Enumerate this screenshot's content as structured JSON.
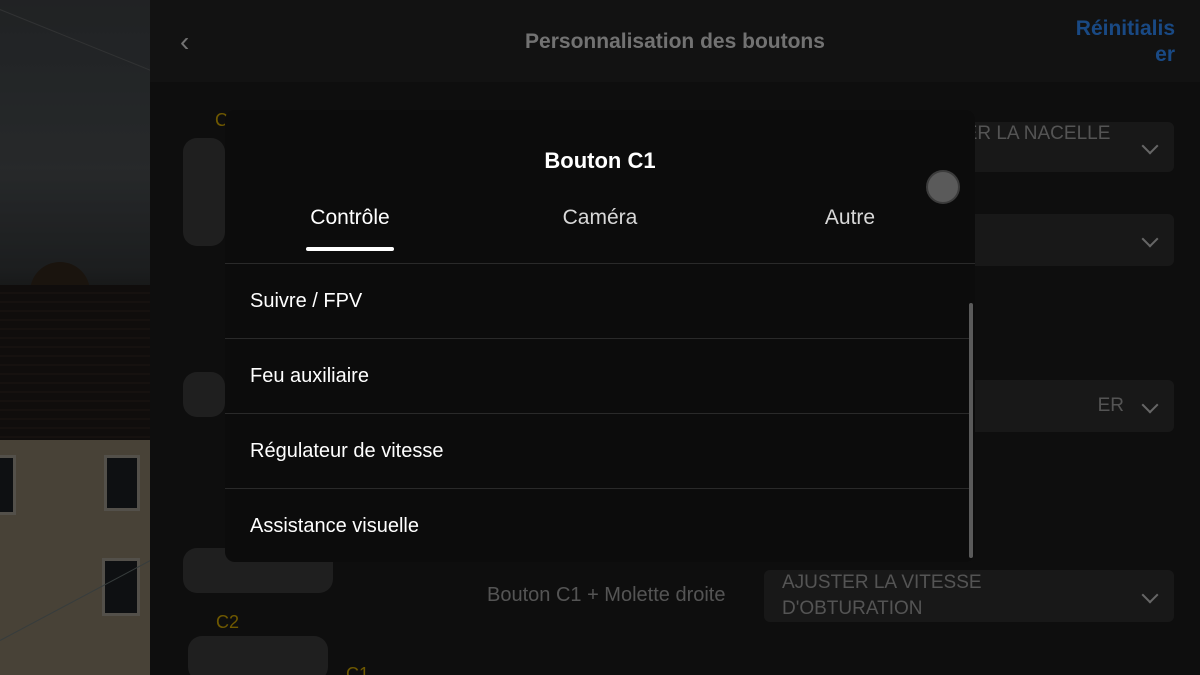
{
  "header": {
    "title": "Personnalisation des boutons",
    "reset_label": "Réinitialiser",
    "back_icon": "chevron-left-icon"
  },
  "background": {
    "controller_labels": [
      "C",
      "C2",
      "C1"
    ],
    "dropdowns": [
      {
        "value": "REMONTER/ABAISSER LA NACELLE VERS LE BAS"
      },
      {
        "value": ""
      },
      {
        "value": "ER"
      },
      {
        "value": "AJUSTER LA VITESSE D'OBTURATION"
      }
    ],
    "combo_label": "Bouton C1 + Molette droite"
  },
  "modal": {
    "title": "Bouton C1",
    "tabs": [
      {
        "label": "Contrôle",
        "active": true
      },
      {
        "label": "Caméra",
        "active": false
      },
      {
        "label": "Autre",
        "active": false
      }
    ],
    "options": [
      {
        "label": "Suivre / FPV"
      },
      {
        "label": "Feu auxiliaire"
      },
      {
        "label": "Régulateur de vitesse"
      },
      {
        "label": "Assistance visuelle"
      }
    ]
  },
  "colors": {
    "accent": "#2f86f0",
    "label_yellow": "#c9a100"
  }
}
